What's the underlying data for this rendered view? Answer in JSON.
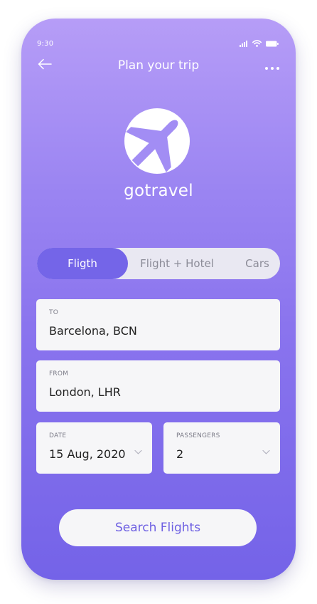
{
  "status_bar": {
    "time": "9:30",
    "icons": [
      "signal-icon",
      "wifi-icon",
      "battery-icon"
    ]
  },
  "header": {
    "back_icon": "arrow-left-icon",
    "title": "Plan your trip",
    "more_icon": "more-dots-icon"
  },
  "brand": {
    "logo_icon": "airplane-logo-icon",
    "name": "gotravel"
  },
  "tabs": [
    {
      "label": "Fligth",
      "active": true
    },
    {
      "label": "Flight + Hotel",
      "active": false
    },
    {
      "label": "Cars",
      "active": false
    }
  ],
  "form": {
    "to": {
      "label": "TO",
      "value": "Barcelona, BCN"
    },
    "from": {
      "label": "FROM",
      "value": "London, LHR"
    },
    "date": {
      "label": "DATE",
      "value": "15 Aug, 2020"
    },
    "passengers": {
      "label": "PASSENGERS",
      "value": "2"
    }
  },
  "search_button": {
    "label": "Search Flights"
  },
  "colors": {
    "gradient_top": "#b69df7",
    "gradient_bottom": "#7463e8",
    "accent": "#7465e8",
    "button_text": "#6e60e2",
    "field_bg": "#f6f6f8"
  }
}
